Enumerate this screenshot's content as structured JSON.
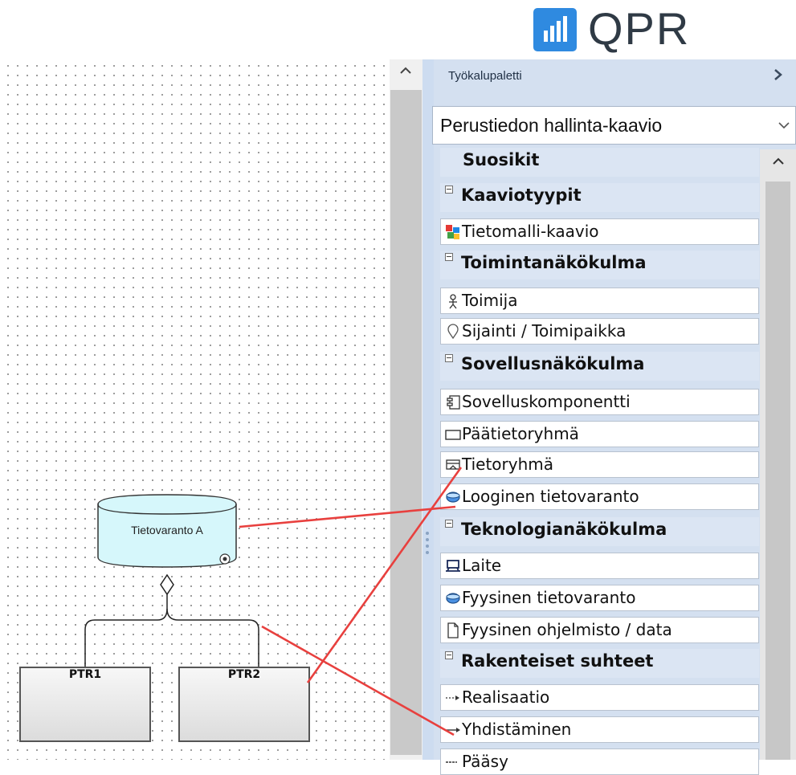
{
  "logo": {
    "text": "QPR",
    "icon": "bar-chart-logo-icon",
    "brand_color": "#2f8ae0"
  },
  "palette": {
    "title": "Työkalupaletti",
    "collapse_icon": "chevron-right-icon",
    "dropdown": {
      "value": "Perustiedon hallinta-kaavio",
      "icon": "chevron-down-icon"
    },
    "favorites_label": "Suosikit",
    "sections": [
      {
        "label": "Kaaviotyypit",
        "items": [
          {
            "label": "Tietomalli-kaavio",
            "icon": "diagram-type-icon"
          }
        ]
      },
      {
        "label": "Toimintanäkökulma",
        "items": [
          {
            "label": "Toimija",
            "icon": "actor-icon"
          },
          {
            "label": "Sijainti / Toimipaikka",
            "icon": "location-pin-icon"
          }
        ]
      },
      {
        "label": "Sovellusnäkökulma",
        "items": [
          {
            "label": "Sovelluskomponentti",
            "icon": "application-component-icon"
          },
          {
            "label": "Päätietoryhmä",
            "icon": "rectangle-icon"
          },
          {
            "label": "Tietoryhmä",
            "icon": "data-group-icon"
          },
          {
            "label": "Looginen tietovaranto",
            "icon": "database-icon"
          }
        ]
      },
      {
        "label": "Teknologianäkökulma",
        "items": [
          {
            "label": "Laite",
            "icon": "device-icon"
          },
          {
            "label": "Fyysinen tietovaranto",
            "icon": "database-icon"
          },
          {
            "label": "Fyysinen ohjelmisto / data",
            "icon": "document-icon"
          }
        ]
      },
      {
        "label": "Rakenteiset suhteet",
        "items": [
          {
            "label": "Realisaatio",
            "icon": "dotted-arrow-icon"
          },
          {
            "label": "Yhdistäminen",
            "icon": "arrow-right-icon"
          },
          {
            "label": "Pääsy",
            "icon": "access-icon"
          }
        ]
      }
    ]
  },
  "diagram": {
    "datastore": {
      "label": "Tietovaranto A"
    },
    "boxes": [
      {
        "label": "PTR1"
      },
      {
        "label": "PTR2"
      }
    ]
  },
  "colors": {
    "annotation_line": "#e8403e",
    "datastore_fill": "#d6f7fb",
    "palette_bg": "#d4e0f0"
  }
}
